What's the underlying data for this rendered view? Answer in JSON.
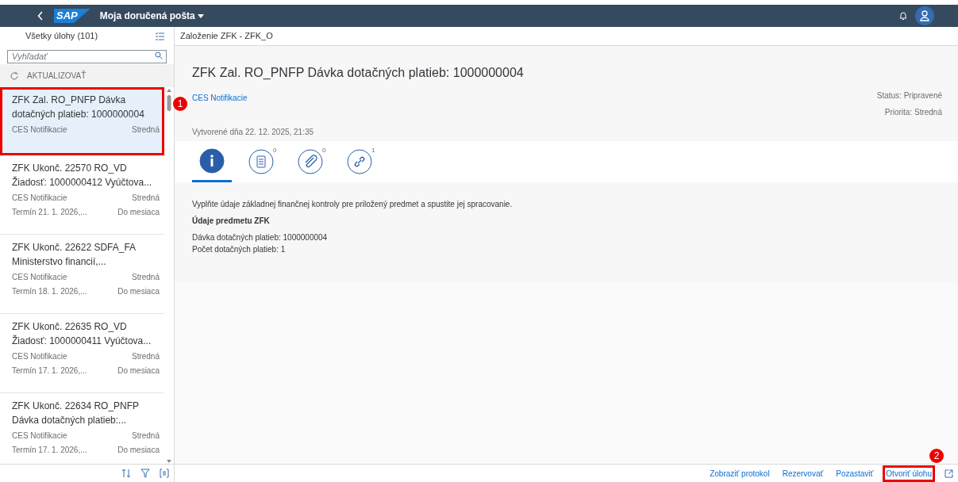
{
  "shell": {
    "logo": "SAP",
    "title": "Moja doručená pošta"
  },
  "list": {
    "title": "Všetky úlohy (101)",
    "search": {
      "placeholder": "Vyhľadať"
    },
    "refresh": "AKTUALIZOVAŤ",
    "items": [
      {
        "title": "ZFK Zal. RO_PNFP Dávka dotačných platieb: 1000000004",
        "source": "CES Notifikacie",
        "priority": "Stredná",
        "selected": true,
        "highlighted": true,
        "callout": "1"
      },
      {
        "title": "ZFK Ukonč. 22570 RO_VD Žiadosť: 1000000412 Vyúčtova...",
        "source": "CES Notifikacie",
        "priority": "Stredná",
        "due": "Termín 21. 1. 2026,...",
        "due_label": "Do mesiaca",
        "selected": false,
        "highlighted": false
      },
      {
        "title": "ZFK Ukonč. 22622 SDFA_FA Ministerstvo financií,...",
        "source": "CES Notifikacie",
        "priority": "Stredná",
        "due": "Termín 18. 1. 2026,...",
        "due_label": "Do mesiaca",
        "selected": false,
        "highlighted": false
      },
      {
        "title": "ZFK Ukonč. 22635 RO_VD Žiadosť: 1000000411 Vyúčtova...",
        "source": "CES Notifikacie",
        "priority": "Stredná",
        "due": "Termín 17. 1. 2026,...",
        "due_label": "Do mesiaca",
        "selected": false,
        "highlighted": false
      },
      {
        "title": "ZFK Ukonč. 22634 RO_PNFP Dávka dotačných platieb:...",
        "source": "CES Notifikacie",
        "priority": "Stredná",
        "due": "Termín 17. 1. 2026,...",
        "due_label": "Do mesiaca",
        "selected": false,
        "highlighted": false
      }
    ]
  },
  "detail": {
    "header": "Založenie ZFK - ZFK_O",
    "title": "ZFK Zal. RO_PNFP Dávka dotačných platieb: 1000000004",
    "source": "CES Notifikacie",
    "status": "Status: Pripravené",
    "priority": "Priorita: Stredná",
    "created": "Vytvorené dňa 22. 12. 2025, 21:35",
    "tabs": [
      {
        "kind": "info",
        "selected": true
      },
      {
        "kind": "notes",
        "count": "0",
        "selected": false
      },
      {
        "kind": "attachments",
        "count": "0",
        "selected": false
      },
      {
        "kind": "links",
        "count": "1",
        "selected": false
      }
    ],
    "description": "Vyplňte údaje základnej finančnej kontroly pre priložený predmet a spustite jej spracovanie.",
    "section_title": "Údaje predmetu ZFK",
    "fields": [
      "Dávka dotačných platieb: 1000000004",
      "Počet dotačných platieb: 1"
    ]
  },
  "footer": {
    "actions": [
      {
        "label": "Zobraziť protokol",
        "highlighted": false
      },
      {
        "label": "Rezervovať",
        "highlighted": false
      },
      {
        "label": "Pozastaviť",
        "highlighted": false
      },
      {
        "label": "Otvoriť úlohu",
        "highlighted": true,
        "callout": "2"
      }
    ]
  }
}
